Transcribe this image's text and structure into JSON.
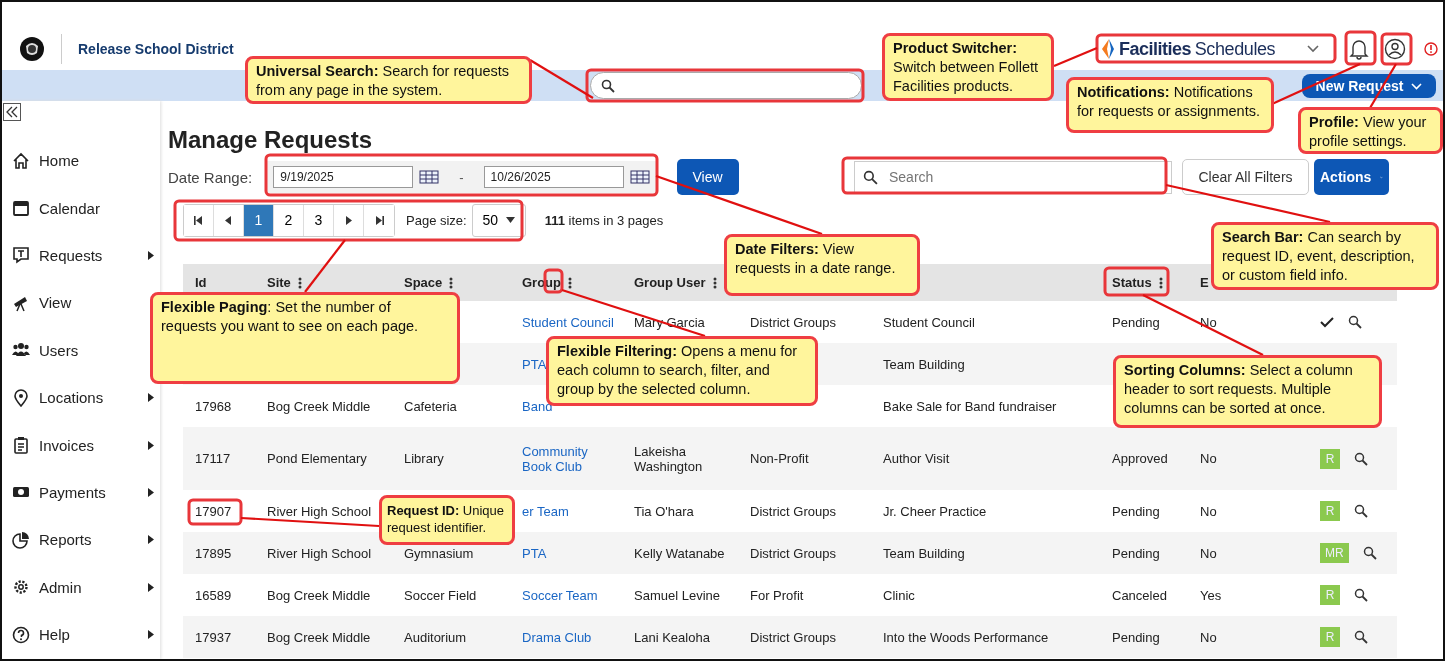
{
  "header": {
    "district": "Release School District",
    "product_switcher": {
      "brand": "Facilities",
      "product": "Schedules"
    },
    "new_request": "New Request"
  },
  "sidebar": {
    "items": [
      {
        "label": "Home",
        "submenu": false
      },
      {
        "label": "Calendar",
        "submenu": false
      },
      {
        "label": "Requests",
        "submenu": true
      },
      {
        "label": "View",
        "submenu": false
      },
      {
        "label": "Users",
        "submenu": false
      },
      {
        "label": "Locations",
        "submenu": true
      },
      {
        "label": "Invoices",
        "submenu": true
      },
      {
        "label": "Payments",
        "submenu": true
      },
      {
        "label": "Reports",
        "submenu": true
      },
      {
        "label": "Admin",
        "submenu": true
      },
      {
        "label": "Help",
        "submenu": true
      }
    ]
  },
  "page": {
    "title": "Manage Requests",
    "date_range": {
      "label": "Date Range:",
      "from": "9/19/2025",
      "separator": "-",
      "to": "10/26/2025",
      "button": "View"
    },
    "search": {
      "placeholder": "Search"
    },
    "clear_filters": "Clear All Filters",
    "actions": "Actions"
  },
  "pager": {
    "pages": [
      {
        "label": "1",
        "selected": true
      },
      {
        "label": "2",
        "selected": false
      },
      {
        "label": "3",
        "selected": false
      }
    ],
    "page_size_label": "Page size:",
    "page_size": "50",
    "summary": "**111** items in 3 pages"
  },
  "table": {
    "columns": [
      {
        "label": "Id",
        "menu": false
      },
      {
        "label": "Site",
        "menu": true
      },
      {
        "label": "Space",
        "menu": true
      },
      {
        "label": "Group",
        "menu": true
      },
      {
        "label": "Group User",
        "menu": true
      },
      null,
      null,
      {
        "label": "Status",
        "menu": true
      },
      {
        "label": "E",
        "menu": false
      },
      null
    ],
    "rows": [
      {
        "cells": [
          null,
          null,
          null,
          "Student Council",
          "Mary Garcia",
          "District Groups",
          "Student Council",
          "Pending",
          "No"
        ],
        "action": {
          "kind": "check"
        }
      },
      {
        "cells": [
          null,
          null,
          null,
          "PTA",
          null,
          null,
          "Team Building",
          null,
          null
        ],
        "action": null
      },
      {
        "cells": [
          "17968",
          "Bog Creek Middle",
          "Cafeteria",
          "Band",
          null,
          null,
          "Bake Sale for Band fundraiser",
          null,
          null
        ],
        "action": null
      },
      {
        "cells": [
          "17117",
          "Pond Elementary",
          "Library",
          "Community Book Club",
          "Lakeisha Washington",
          "Non-Profit",
          "Author Visit",
          "Approved",
          "No"
        ],
        "action": {
          "kind": "badge",
          "label": "R"
        }
      },
      {
        "cells": [
          "17907",
          "River High School",
          null,
          "er Team",
          "Tia O'hara",
          "District Groups",
          "Jr. Cheer Practice",
          "Pending",
          "No"
        ],
        "action": {
          "kind": "badge",
          "label": "R"
        }
      },
      {
        "cells": [
          "17895",
          "River High School",
          "Gymnasium",
          "PTA",
          "Kelly Watanabe",
          "District Groups",
          "Team Building",
          "Pending",
          "No"
        ],
        "action": {
          "kind": "badge",
          "label": "MR"
        }
      },
      {
        "cells": [
          "16589",
          "Bog Creek Middle",
          "Soccer Field",
          "Soccer Team",
          "Samuel Levine",
          "For Profit",
          "Clinic",
          "Canceled",
          "Yes"
        ],
        "action": {
          "kind": "badge",
          "label": "R"
        }
      },
      {
        "cells": [
          "17937",
          "Bog Creek Middle",
          "Auditorium",
          "Drama Club",
          "Lani Kealoha",
          "District Groups",
          "Into the Woods Performance",
          "Pending",
          "No"
        ],
        "action": {
          "kind": "badge",
          "label": "R"
        }
      }
    ]
  },
  "callouts": [
    "**Universal Search:** Search for requests from any page in the system.",
    "**Product Switcher:** Switch between Follett Facilities products.",
    "**Notifications:** Notifications for requests or assignments.",
    "**Profile:** View your profile settings.",
    "**Date Filters:** View requests in a date range.",
    "**Search Bar:** Can search by request ID, event, description, or custom field info.",
    "**Flexible Paging**: Set the number of requests you want to see on each page.",
    "**Flexible Filtering:** Opens a menu for each column to search, filter, and group by the selected column.",
    "**Sorting Columns:** Select a column header to sort requests. Multiple columns can be sorted at once.",
    "**Request ID:** Unique request identifier."
  ]
}
